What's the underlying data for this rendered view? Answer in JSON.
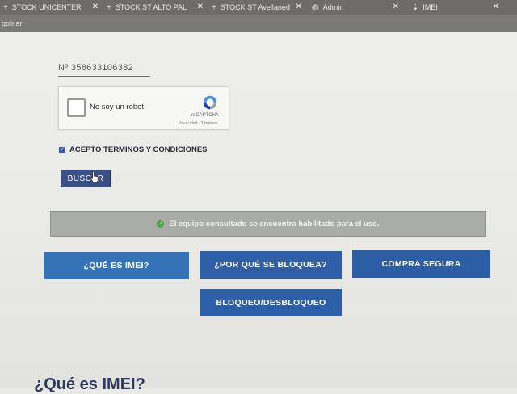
{
  "browser": {
    "tabs": [
      {
        "label": "STOCK UNICENTER",
        "icon": "plus-icon"
      },
      {
        "label": "STOCK ST ALTO PAL",
        "icon": "plus-icon"
      },
      {
        "label": "STOCK ST Avellaneda",
        "icon": "plus-icon"
      },
      {
        "label": "Admin",
        "icon": "globe-icon"
      },
      {
        "label": "IMEI",
        "icon": "download-icon"
      }
    ],
    "url_fragment": "gob.ar"
  },
  "form": {
    "imei_value": "Nº 358633106382",
    "captcha": {
      "label": "No soy un robot",
      "brand": "reCAPTCHA",
      "terms": "Privacidad - Términos"
    },
    "terms_label": "ACEPTO TERMINOS Y CONDICIONES",
    "terms_checked": true,
    "search_button": "BUSCAR"
  },
  "result": {
    "message": "El equipo consultado se encuentra habilitado para el uso.",
    "status_color": "#4aa544"
  },
  "nav_buttons": [
    "¿QUÉ ES IMEI?",
    "¿POR QUÉ SE BLOQUEA?",
    "COMPRA SEGURA",
    "BLOQUEO/DESBLOQUEO"
  ],
  "section_title": "¿Qué es IMEI?"
}
